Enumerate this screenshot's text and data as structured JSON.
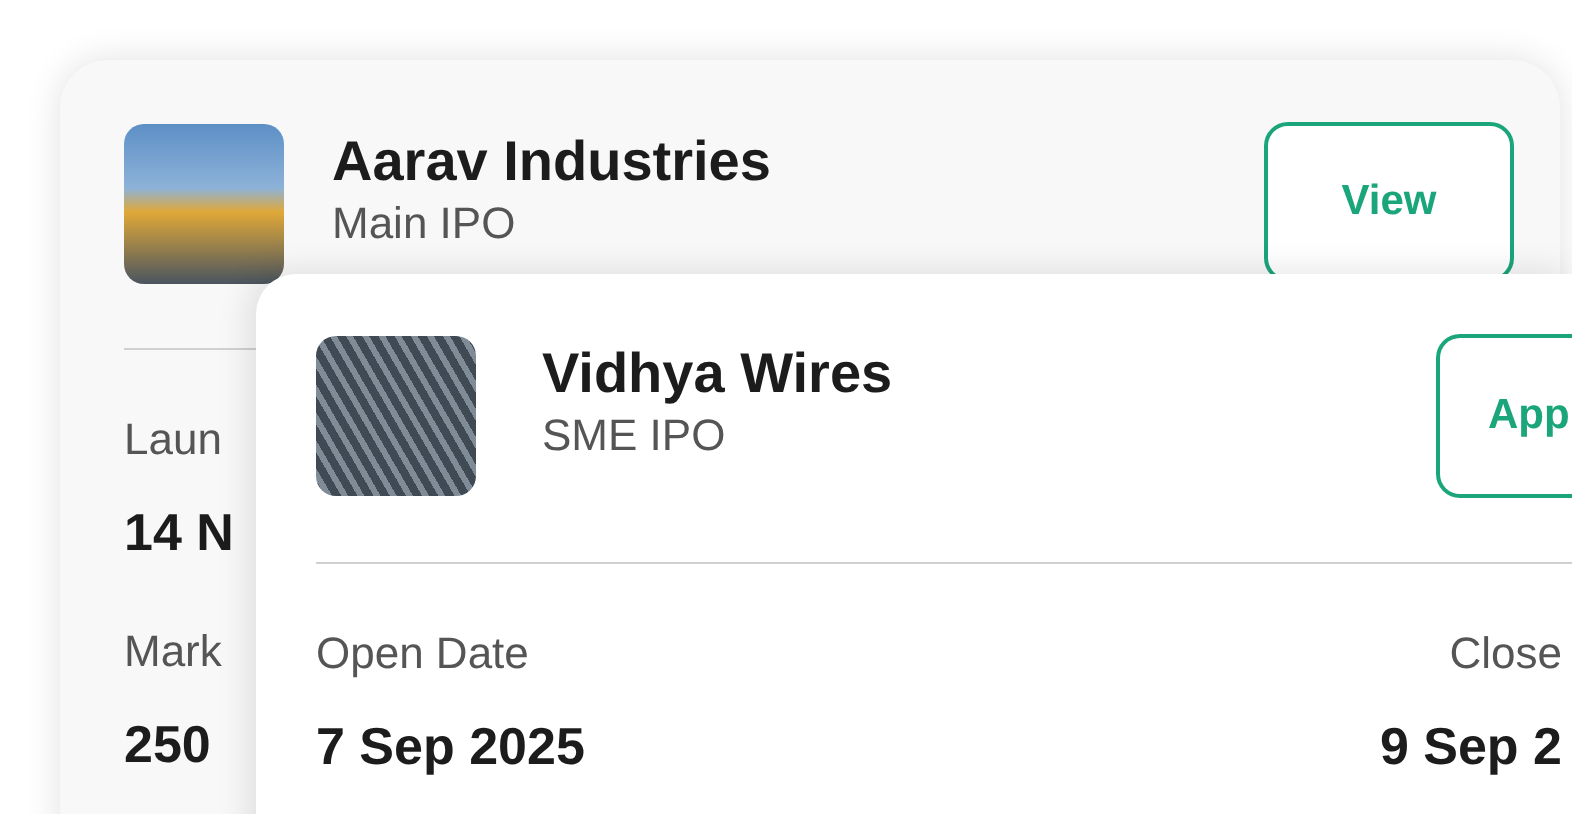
{
  "back_card": {
    "title": "Aarav Industries",
    "subtitle": "Main IPO",
    "button": "View",
    "details": [
      {
        "label": "Laun",
        "value": "14 N"
      },
      {
        "label": "Mark",
        "value": "250"
      }
    ]
  },
  "front_card": {
    "title": "Vidhya Wires",
    "subtitle": "SME IPO",
    "button": "App",
    "details": [
      {
        "label": "Open Date",
        "value": "7 Sep 2025"
      },
      {
        "label": "Close",
        "value": "9 Sep 2"
      }
    ]
  }
}
